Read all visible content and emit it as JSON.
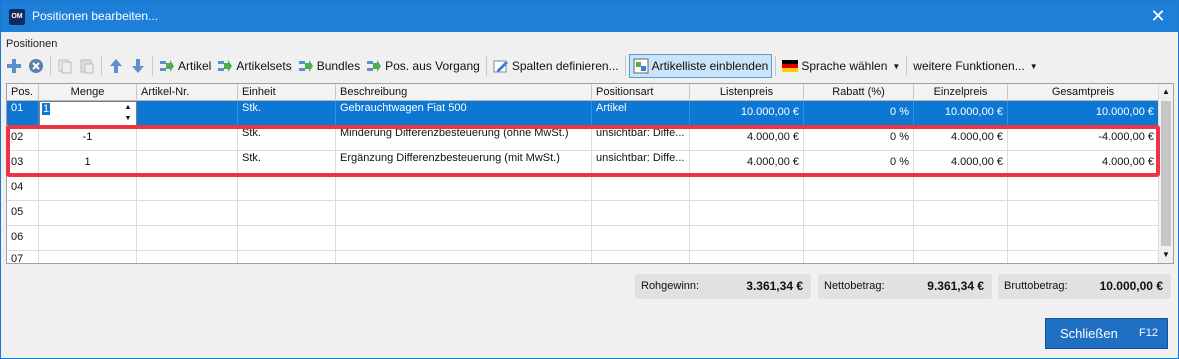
{
  "window": {
    "title": "Positionen bearbeiten...",
    "app_icon": "OM"
  },
  "section_label": "Positionen",
  "toolbar": {
    "artikel": "Artikel",
    "artikelsets": "Artikelsets",
    "bundles": "Bundles",
    "pos_aus_vorgang": "Pos. aus Vorgang",
    "spalten": "Spalten definieren...",
    "artikelliste": "Artikelliste einblenden",
    "sprache": "Sprache wählen",
    "weitere": "weitere Funktionen..."
  },
  "columns": {
    "pos": "Pos.",
    "menge": "Menge",
    "artikel_nr": "Artikel-Nr.",
    "einheit": "Einheit",
    "beschreibung": "Beschreibung",
    "positionsart": "Positionsart",
    "listenpreis": "Listenpreis",
    "rabatt": "Rabatt (%)",
    "einzelpreis": "Einzelpreis",
    "gesamtpreis": "Gesamtpreis"
  },
  "rows": [
    {
      "pos": "01",
      "menge": "1",
      "artikel_nr": "",
      "einheit": "Stk.",
      "beschreibung": "Gebrauchtwagen Fiat 500",
      "positionsart": "Artikel",
      "listenpreis": "10.000,00 €",
      "rabatt": "0 %",
      "einzelpreis": "10.000,00 €",
      "gesamtpreis": "10.000,00 €"
    },
    {
      "pos": "02",
      "menge": "-1",
      "artikel_nr": "",
      "einheit": "Stk.",
      "beschreibung": "Minderung Differenzbesteuerung (ohne MwSt.)",
      "positionsart": "unsichtbar: Diffe...",
      "listenpreis": "4.000,00 €",
      "rabatt": "0 %",
      "einzelpreis": "4.000,00 €",
      "gesamtpreis": "-4.000,00 €"
    },
    {
      "pos": "03",
      "menge": "1",
      "artikel_nr": "",
      "einheit": "Stk.",
      "beschreibung": "Ergänzung Differenzbesteuerung (mit MwSt.)",
      "positionsart": "unsichtbar: Diffe...",
      "listenpreis": "4.000,00 €",
      "rabatt": "0 %",
      "einzelpreis": "4.000,00 €",
      "gesamtpreis": "4.000,00 €"
    },
    {
      "pos": "04"
    },
    {
      "pos": "05"
    },
    {
      "pos": "06"
    },
    {
      "pos": "07"
    }
  ],
  "summary": {
    "rohgewinn_label": "Rohgewinn:",
    "rohgewinn_value": "3.361,34 €",
    "netto_label": "Nettobetrag:",
    "netto_value": "9.361,34 €",
    "brutto_label": "Bruttobetrag:",
    "brutto_value": "10.000,00 €"
  },
  "footer": {
    "close_label": "Schließen",
    "close_key": "F12"
  },
  "colors": {
    "accent": "#1e7fd8",
    "selection": "#0c78d4",
    "highlight": "#ee3347"
  }
}
